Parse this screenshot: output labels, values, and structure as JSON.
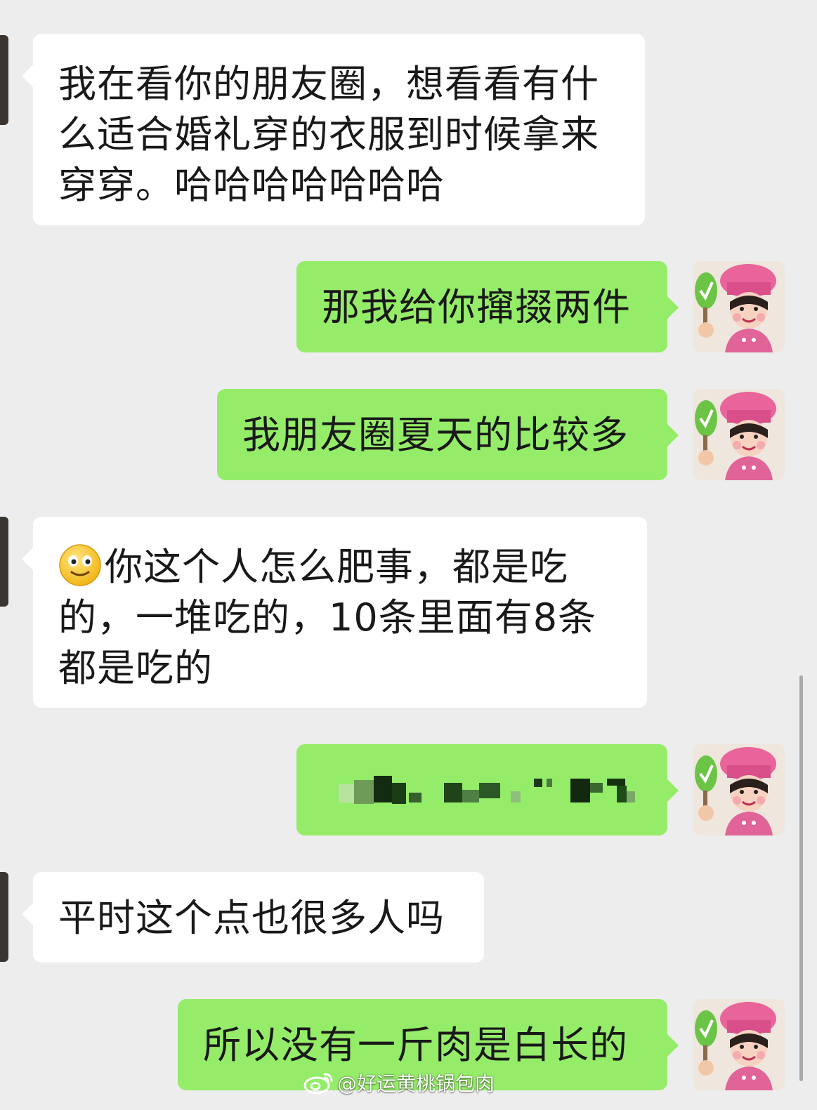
{
  "chat": {
    "messages": [
      {
        "side": "in",
        "text": "我在看你的朋友圈，想看看有什么适合婚礼穿的衣服到时候拿来穿穿。哈哈哈哈哈哈哈"
      },
      {
        "side": "out",
        "text": "那我给你撺掇两件"
      },
      {
        "side": "out",
        "text": "我朋友圈夏天的比较多"
      },
      {
        "side": "in",
        "emoji": "slight-smile-emoji",
        "text": "你这个人怎么肥事，都是吃的，一堆吃的，10条里面有8条都是吃的"
      },
      {
        "side": "out",
        "text": "",
        "note": "pixelated-censored"
      },
      {
        "side": "in",
        "text": "平时这个点也很多人吗"
      },
      {
        "side": "out",
        "text": "所以没有一斤肉是白长的"
      }
    ]
  },
  "watermark": {
    "text": "@好运黄桃锅包肉",
    "icon": "weibo-icon"
  },
  "colors": {
    "background": "#ededed",
    "incoming_bubble": "#ffffff",
    "outgoing_bubble": "#95ec69",
    "text": "#191919"
  }
}
